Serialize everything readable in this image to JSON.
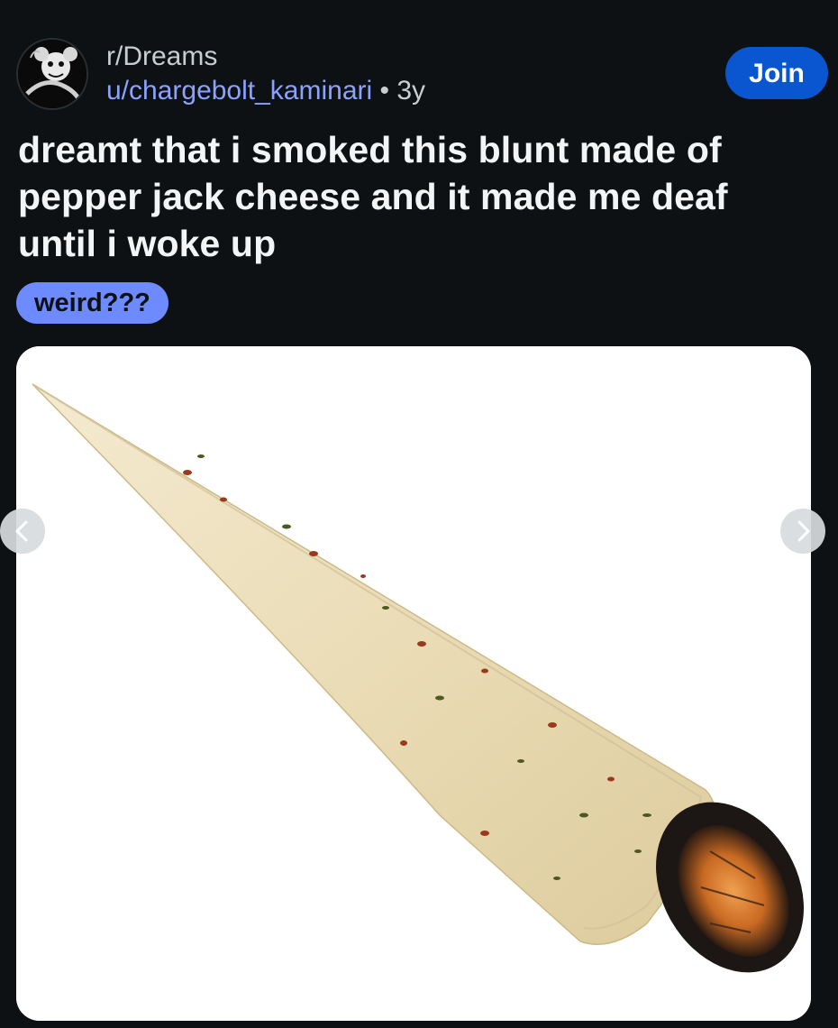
{
  "post": {
    "subreddit": "r/Dreams",
    "author": "u/chargebolt_kaminari",
    "separator": "•",
    "age": "3y",
    "join_label": "Join",
    "title": "dreamt that i smoked this blunt made of pepper jack cheese and it made me deaf until i woke up",
    "flair": "weird???"
  },
  "icons": {
    "avatar": "subreddit-avatar",
    "prev": "chevron-left-icon",
    "next": "chevron-right-icon"
  },
  "colors": {
    "background": "#0e1113",
    "join_button": "#0a56d0",
    "author_link": "#8ba3ff",
    "flair_bg": "#6d8bff"
  }
}
